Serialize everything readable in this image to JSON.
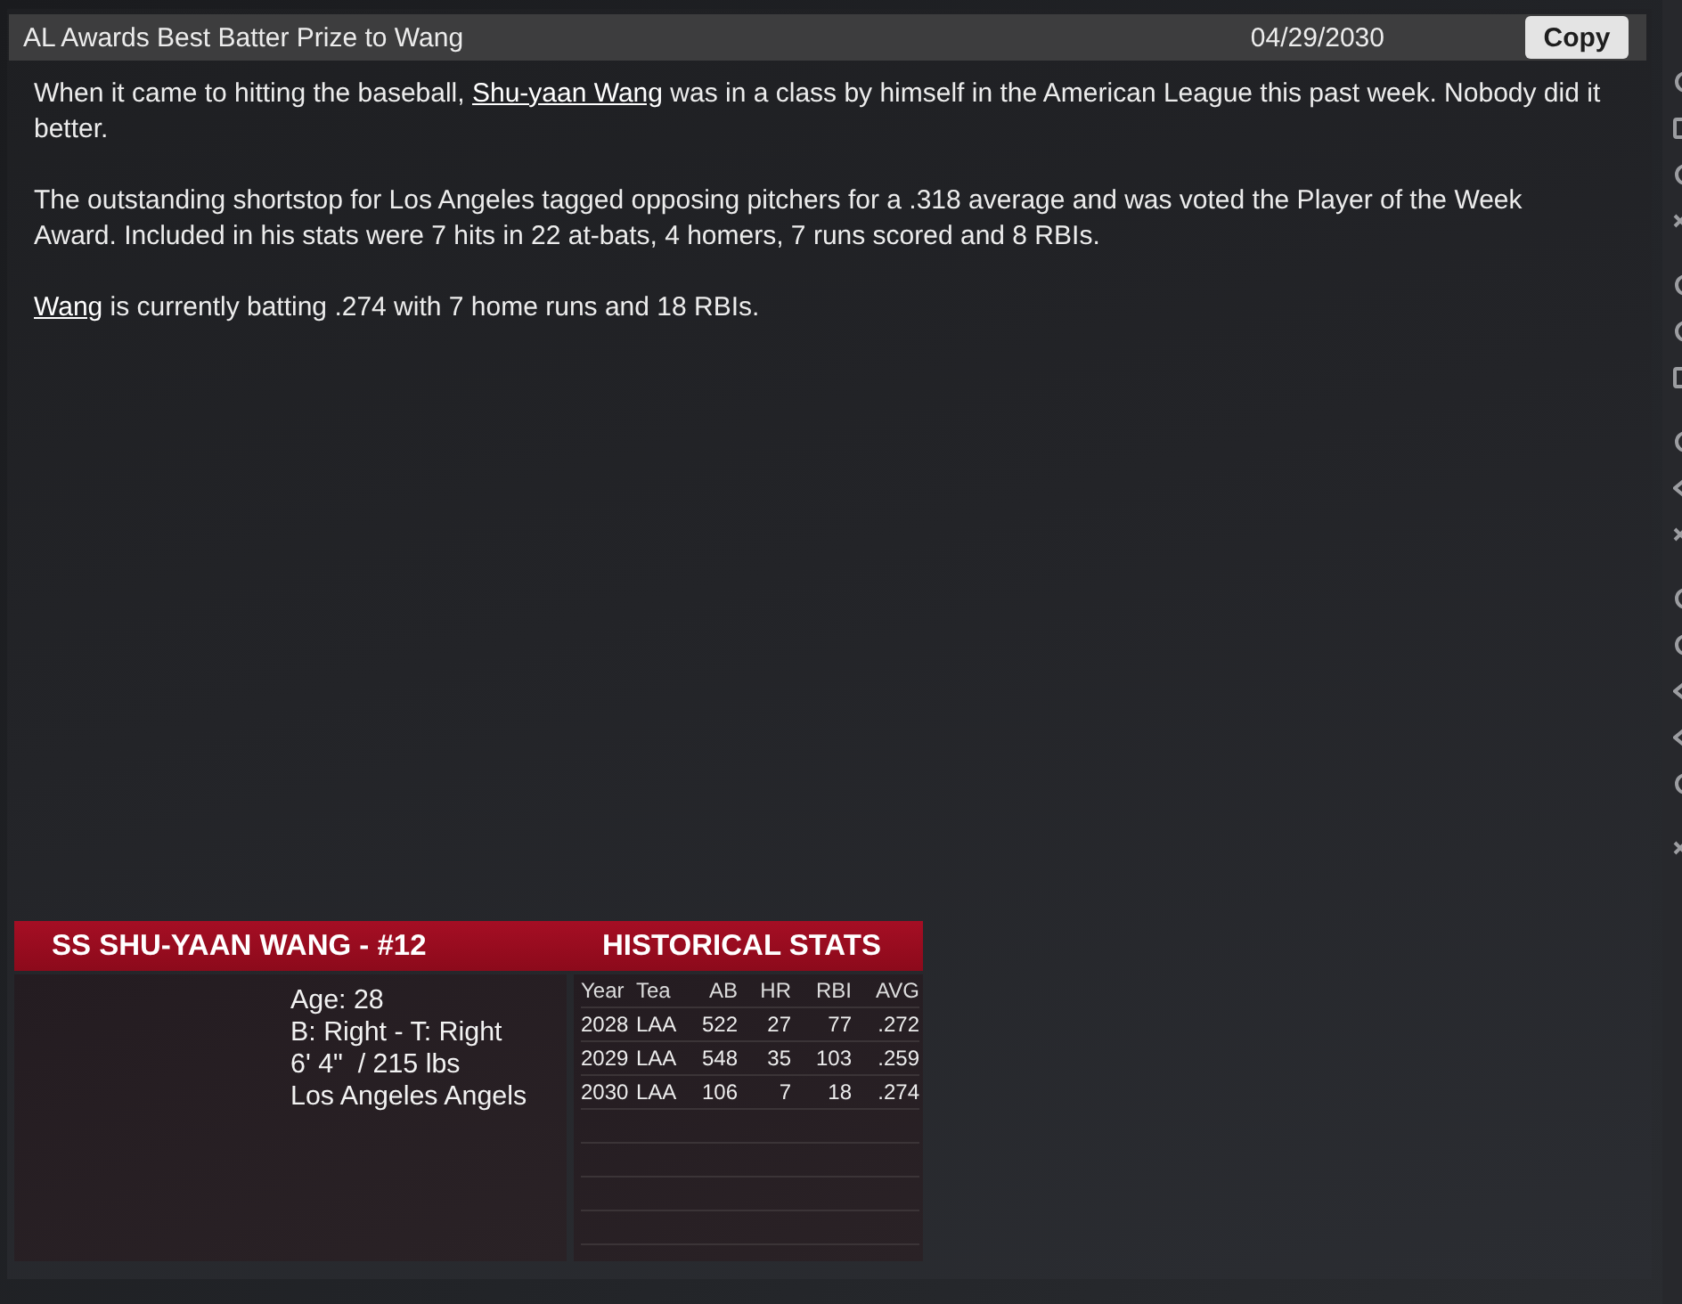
{
  "article": {
    "title": "AL Awards Best Batter Prize to Wang",
    "date": "04/29/2030",
    "copy_button": "Copy",
    "paragraphs": [
      [
        {
          "kind": "text",
          "text": "When it came to hitting the baseball, "
        },
        {
          "kind": "link",
          "text": "Shu-yaan Wang"
        },
        {
          "kind": "text",
          "text": " was in a class by himself in the American League this past week. Nobody did it better."
        }
      ],
      [
        {
          "kind": "text",
          "text": "The outstanding shortstop for Los Angeles tagged opposing pitchers for a .318 average and was voted the Player of the Week Award. Included in his stats were 7 hits in 22 at-bats, 4 homers, 7 runs scored and 8 RBIs."
        }
      ],
      [
        {
          "kind": "link",
          "text": "Wang"
        },
        {
          "kind": "text",
          "text": " is currently batting .274 with 7 home runs and 18 RBIs."
        }
      ]
    ]
  },
  "player_card": {
    "header": "SS SHU-YAAN WANG - #12",
    "details": [
      "Age: 28",
      "B: Right - T: Right",
      "6' 4\"  / 215 lbs",
      "Los Angeles Angels"
    ]
  },
  "historical_stats": {
    "title": "HISTORICAL STATS",
    "columns": [
      "Year",
      "Tea",
      "AB",
      "HR",
      "RBI",
      "AVG"
    ],
    "rows": [
      [
        "2028",
        "LAA",
        "522",
        "27",
        "77",
        ".272"
      ],
      [
        "2029",
        "LAA",
        "548",
        "35",
        "103",
        ".259"
      ],
      [
        "2030",
        "LAA",
        "106",
        "7",
        "18",
        ".274"
      ]
    ]
  }
}
